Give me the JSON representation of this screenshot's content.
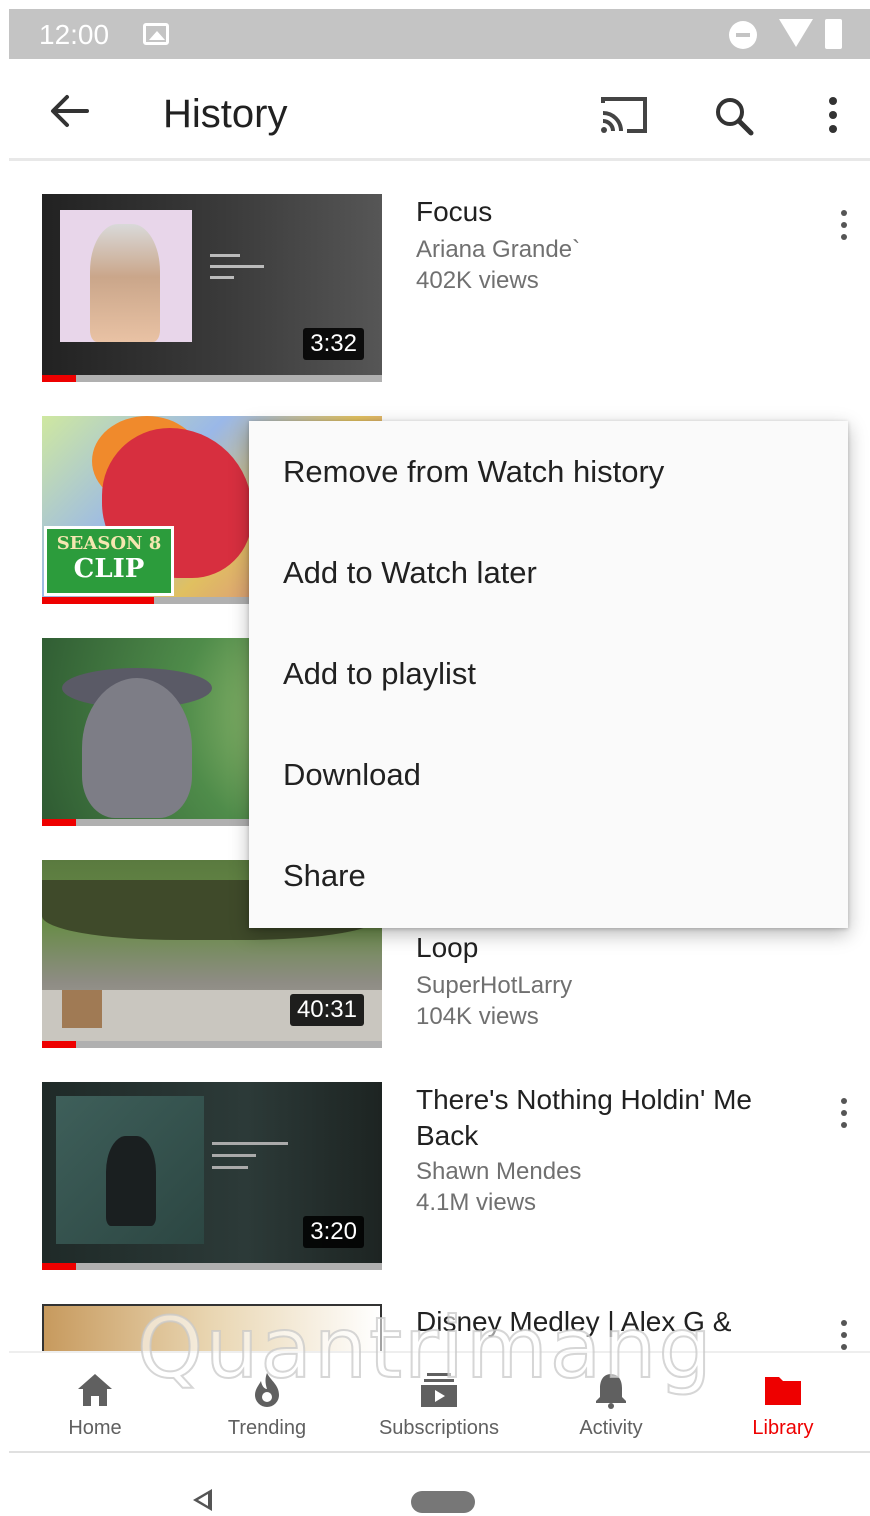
{
  "status_bar": {
    "time": "12:00"
  },
  "app_bar": {
    "title": "History"
  },
  "videos": [
    {
      "title": "Focus",
      "channel": "Ariana Grande`",
      "views": "402K views",
      "duration": "3:32",
      "progress": 0.1
    },
    {
      "title": "",
      "channel": "",
      "views": "",
      "duration": "",
      "progress": 0.33,
      "badge_line1": "SEASON 8",
      "badge_line2": "CLIP"
    },
    {
      "title": "",
      "channel": "",
      "views": "",
      "duration": "",
      "progress": 0.1
    },
    {
      "title": "Loop",
      "channel": "SuperHotLarry",
      "views": "104K views",
      "duration": "40:31",
      "progress": 0.1
    },
    {
      "title": "There's Nothing Holdin' Me Back",
      "channel": "Shawn Mendes",
      "views": "4.1M views",
      "duration": "3:20",
      "progress": 0.1
    },
    {
      "title": "Disney Medley | Alex G &",
      "channel": "",
      "views": "",
      "duration": "",
      "progress": 0
    }
  ],
  "context_menu": {
    "items": [
      "Remove from Watch history",
      "Add to Watch later",
      "Add to playlist",
      "Download",
      "Share"
    ]
  },
  "bottom_nav": {
    "items": [
      {
        "label": "Home",
        "icon": "home-icon"
      },
      {
        "label": "Trending",
        "icon": "trending-icon"
      },
      {
        "label": "Subscriptions",
        "icon": "subscriptions-icon"
      },
      {
        "label": "Activity",
        "icon": "activity-bell-icon"
      },
      {
        "label": "Library",
        "icon": "library-folder-icon",
        "active": true
      }
    ]
  },
  "watermark": "Quantrimang",
  "colors": {
    "accent": "#ee0000",
    "status_bar": "#c4c4c4",
    "menu_bg": "#fafafa"
  }
}
